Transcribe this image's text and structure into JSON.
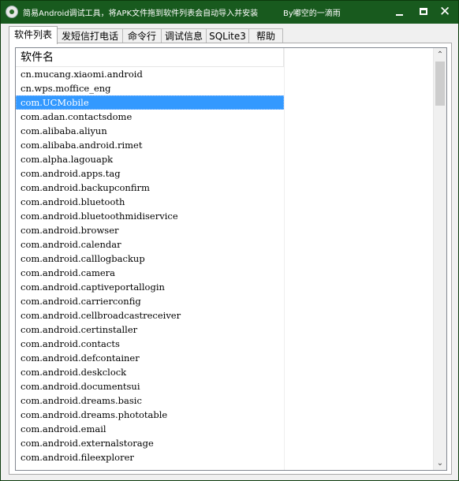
{
  "window": {
    "title": "简易Android调试工具，将APK文件拖到软件列表会自动导入并安装",
    "author": "By嘟空的一滴雨",
    "controls": {
      "minimize_icon": "minimize-icon",
      "maximize_icon": "maximize-icon",
      "close_icon": "close-icon"
    },
    "title_bg": "#185a1e"
  },
  "tabs": [
    {
      "label": "软件列表",
      "active": true
    },
    {
      "label": "发短信打电话",
      "active": false
    },
    {
      "label": "命令行",
      "active": false
    },
    {
      "label": "调试信息",
      "active": false
    },
    {
      "label": "SQLite3",
      "active": false
    },
    {
      "label": "帮助",
      "active": false
    }
  ],
  "list": {
    "column_header": "软件名",
    "selected_color": "#3399ff",
    "items": [
      "cn.mucang.xiaomi.android",
      "cn.wps.moffice_eng",
      "com.UCMobile",
      "com.adan.contactsdome",
      "com.alibaba.aliyun",
      "com.alibaba.android.rimet",
      "com.alpha.lagouapk",
      "com.android.apps.tag",
      "com.android.backupconfirm",
      "com.android.bluetooth",
      "com.android.bluetoothmidiservice",
      "com.android.browser",
      "com.android.calendar",
      "com.android.calllogbackup",
      "com.android.camera",
      "com.android.captiveportallogin",
      "com.android.carrierconfig",
      "com.android.cellbroadcastreceiver",
      "com.android.certinstaller",
      "com.android.contacts",
      "com.android.defcontainer",
      "com.android.deskclock",
      "com.android.documentsui",
      "com.android.dreams.basic",
      "com.android.dreams.phototable",
      "com.android.email",
      "com.android.externalstorage",
      "com.android.fileexplorer"
    ],
    "selected_index": 2
  }
}
